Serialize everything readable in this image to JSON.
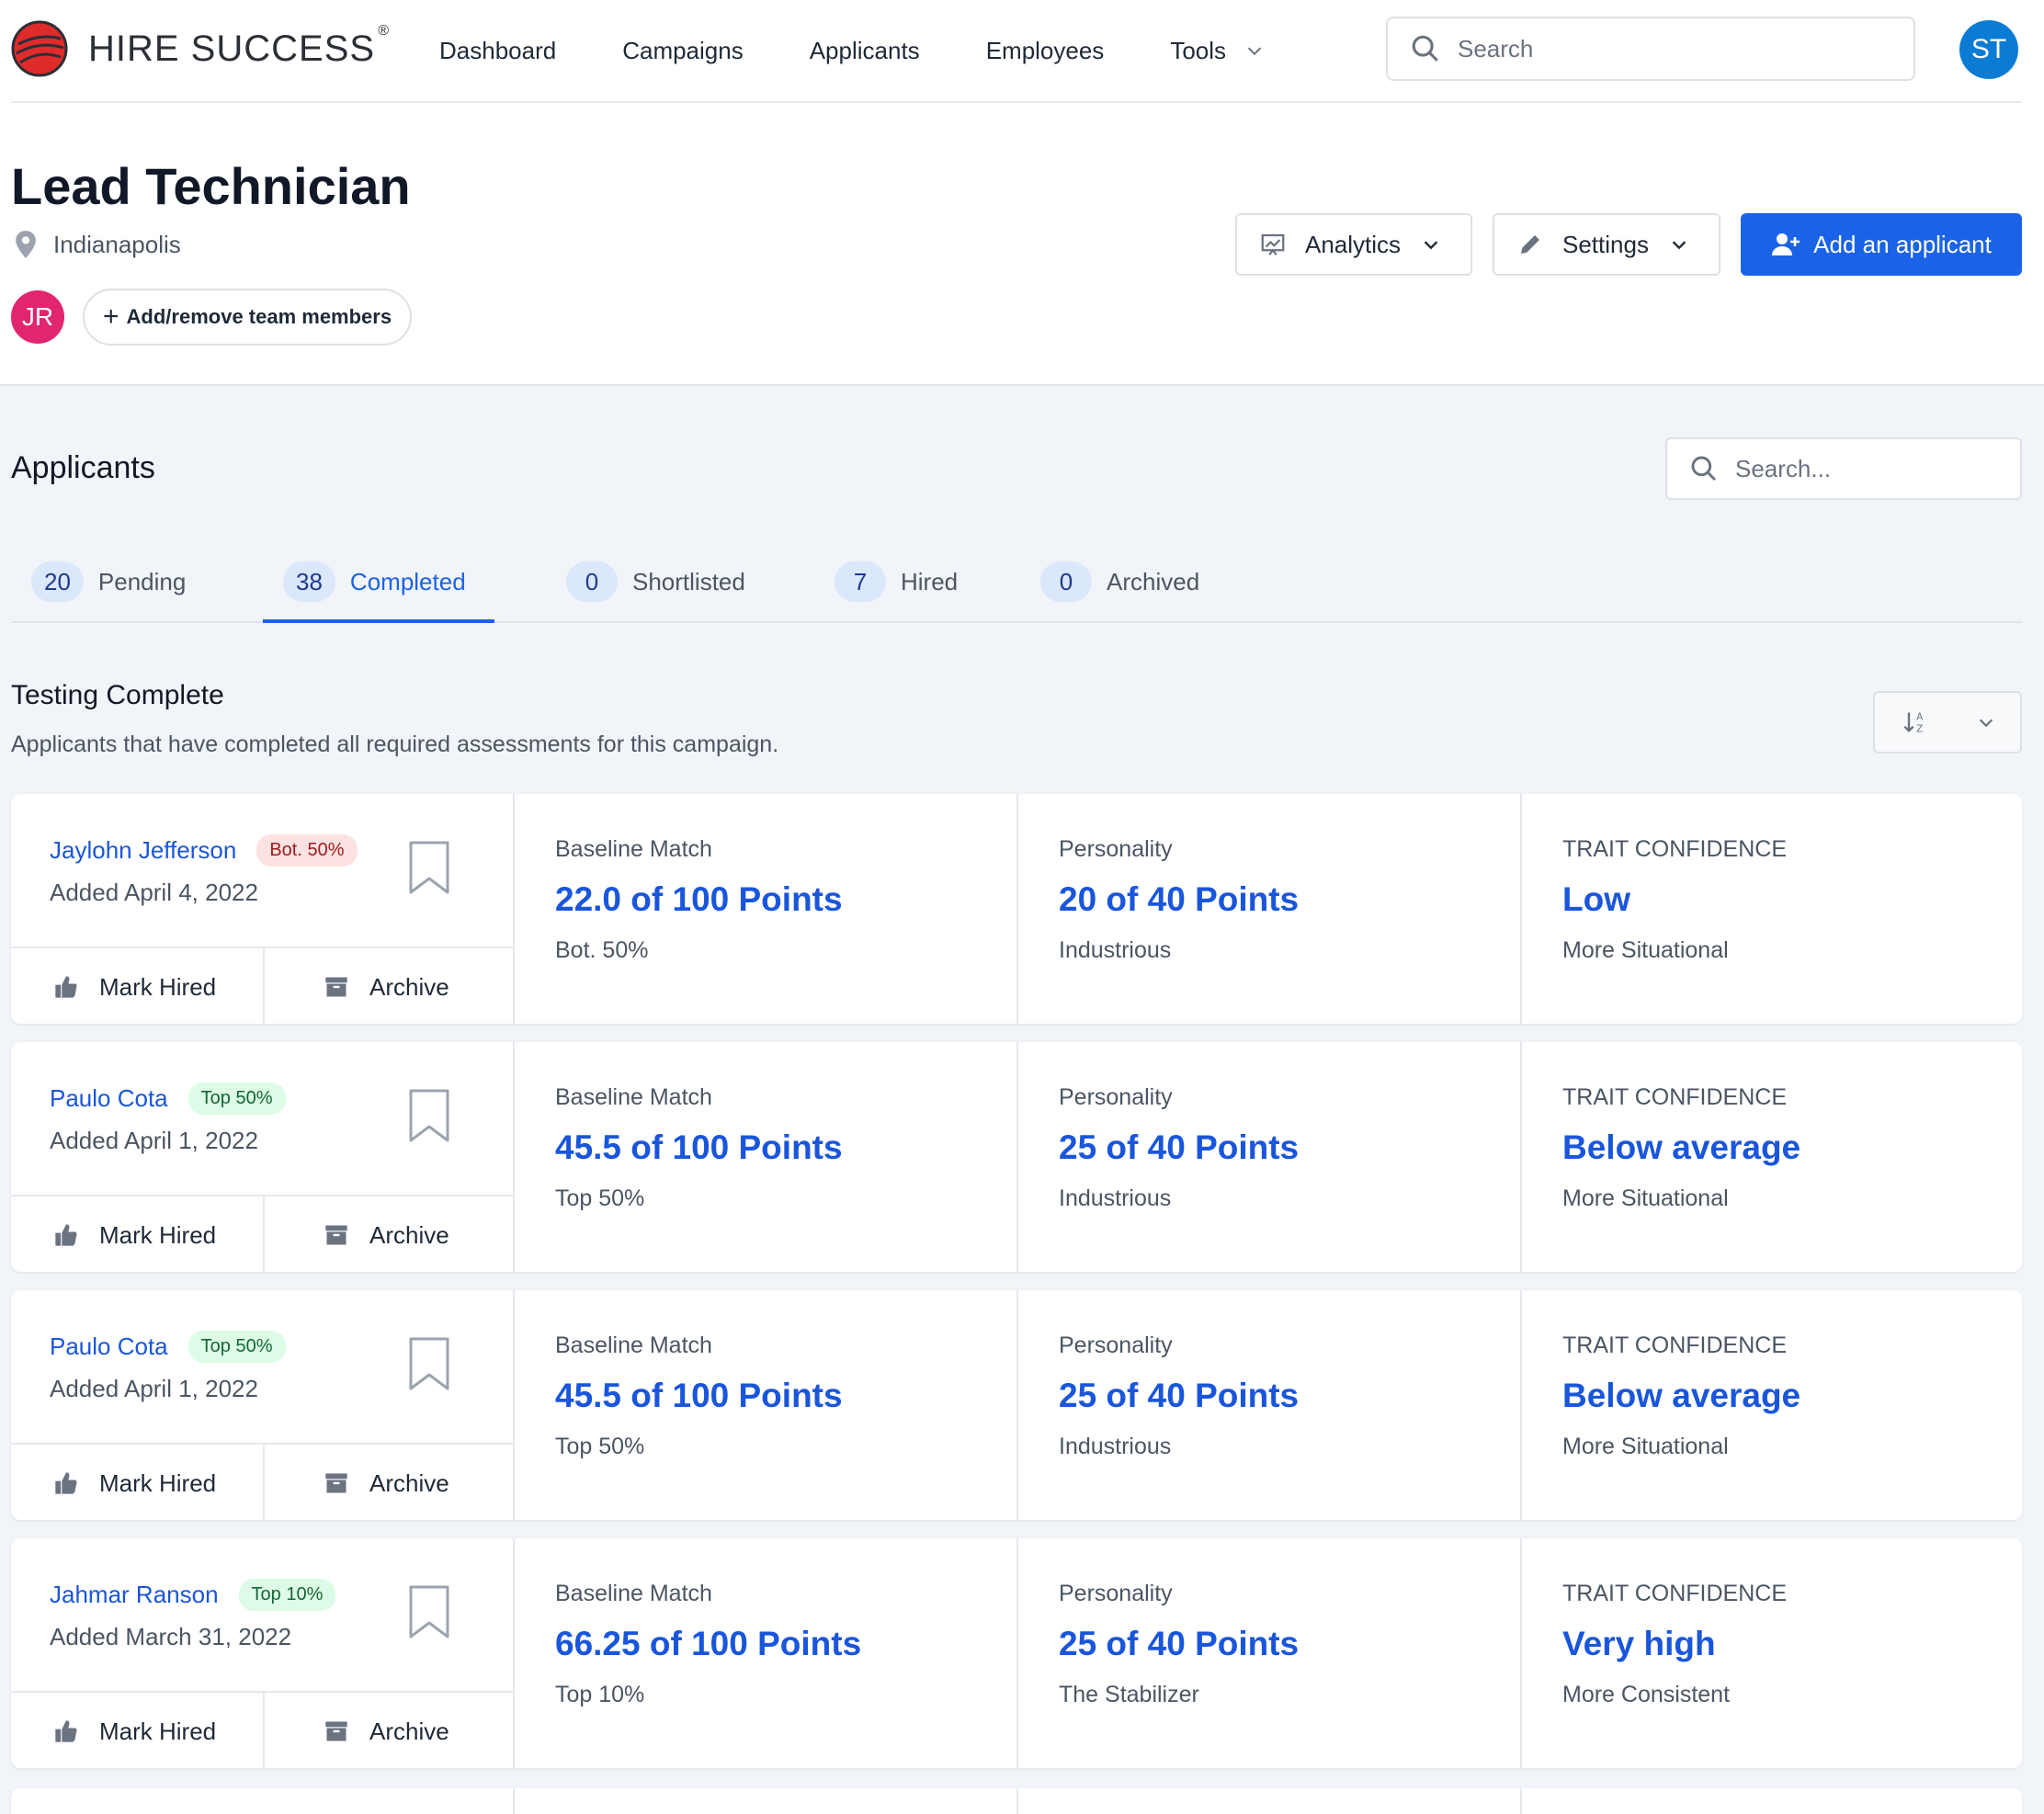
{
  "brand": {
    "name": "HIRE SUCCESS",
    "mark": "®",
    "accent": "#1a63e6"
  },
  "nav": {
    "items": [
      "Dashboard",
      "Campaigns",
      "Applicants",
      "Employees",
      "Tools"
    ],
    "search_placeholder": "Search",
    "user_initials": "ST"
  },
  "header": {
    "title": "Lead Technician",
    "location": "Indianapolis",
    "member_initials": "JR",
    "team_button": "Add/remove team members",
    "analytics": "Analytics",
    "settings": "Settings",
    "add_applicant": "Add an applicant"
  },
  "applicants": {
    "title": "Applicants",
    "search_placeholder": "Search...",
    "tabs": [
      {
        "count": "20",
        "label": "Pending"
      },
      {
        "count": "38",
        "label": "Completed"
      },
      {
        "count": "0",
        "label": "Shortlisted"
      },
      {
        "count": "7",
        "label": "Hired"
      },
      {
        "count": "0",
        "label": "Archived"
      }
    ],
    "group_title": "Testing Complete",
    "group_subtitle": "Applicants that have completed all required assessments for this campaign.",
    "actions": {
      "hired": "Mark Hired",
      "archive": "Archive"
    },
    "labels": {
      "baseline": "Baseline Match",
      "personality": "Personality",
      "trait": "TRAIT CONFIDENCE"
    },
    "cards": [
      {
        "name": "Jaylohn Jefferson",
        "badge": "Bot. 50%",
        "added": "Added April 4, 2022",
        "baseline": "22.0 of 100 Points",
        "baseline_sub": "Bot. 50%",
        "personality": "20 of 40 Points",
        "personality_sub": "Industrious",
        "trait": "Low",
        "trait_sub": "More Situational"
      },
      {
        "name": "Paulo Cota",
        "badge": "Top 50%",
        "added": "Added April 1, 2022",
        "baseline": "45.5 of 100 Points",
        "baseline_sub": "Top 50%",
        "personality": "25 of 40 Points",
        "personality_sub": "Industrious",
        "trait": "Below average",
        "trait_sub": "More Situational"
      },
      {
        "name": "Paulo Cota",
        "badge": "Top 50%",
        "added": "Added April 1, 2022",
        "baseline": "45.5 of 100 Points",
        "baseline_sub": "Top 50%",
        "personality": "25 of 40 Points",
        "personality_sub": "Industrious",
        "trait": "Below average",
        "trait_sub": "More Situational"
      },
      {
        "name": "Jahmar Ranson",
        "badge": "Top 10%",
        "added": "Added March 31, 2022",
        "baseline": "66.25 of 100 Points",
        "baseline_sub": "Top 10%",
        "personality": "25 of 40 Points",
        "personality_sub": "The Stabilizer",
        "trait": "Very high",
        "trait_sub": "More Consistent"
      }
    ]
  }
}
